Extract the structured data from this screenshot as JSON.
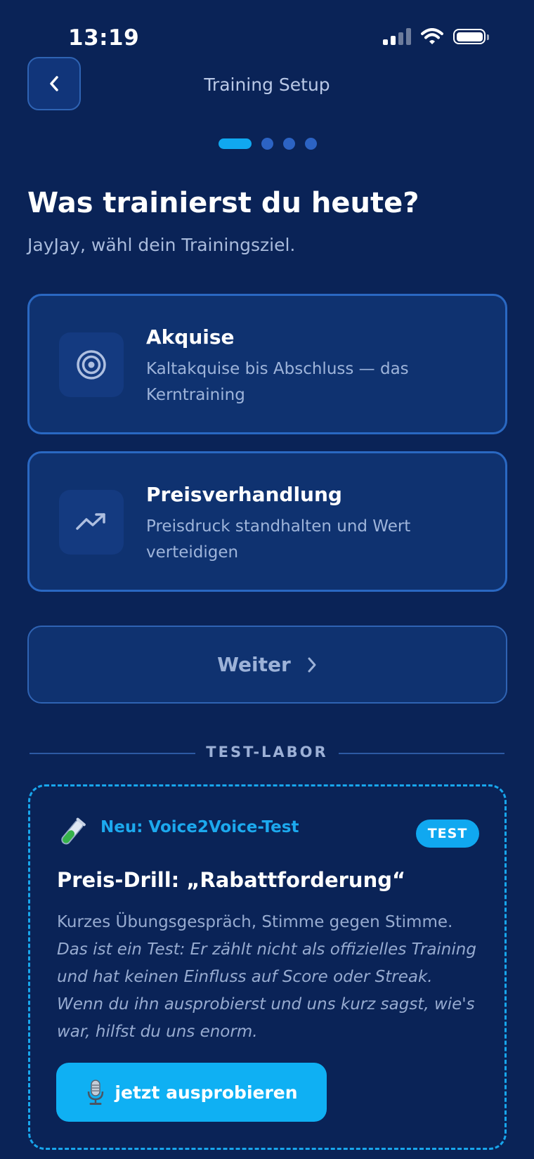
{
  "status_bar": {
    "time": "13:19"
  },
  "nav": {
    "title": "Training Setup"
  },
  "step_indicator": {
    "current": 1,
    "total": 4
  },
  "header": {
    "title": "Was trainierst du heute?",
    "subtitle": "JayJay, wähl dein Trainingsziel."
  },
  "options": [
    {
      "title": "Akquise",
      "description": "Kaltakquise bis Abschluss — das Kerntraining",
      "icon": "target-icon"
    },
    {
      "title": "Preisverhandlung",
      "description": "Preisdruck standhalten und Wert verteidigen",
      "icon": "trending-up-icon"
    }
  ],
  "continue_button": {
    "label": "Weiter"
  },
  "test_lab": {
    "section_label": "TEST-LABOR",
    "tag": "Neu: Voice2Voice-Test",
    "badge": "TEST",
    "title": "Preis-Drill: „Rabattforderung“",
    "description": "Kurzes Übungsgespräch, Stimme gegen Stimme.",
    "note": "Das ist ein Test: Er zählt nicht als offizielles Training und hat keinen Einfluss auf Score oder Streak. Wenn du ihn ausprobierst und uns kurz sagst, wie's war, hilfst du uns enorm.",
    "try_button": "jetzt ausprobieren",
    "tag_icon": "test-tube-icon",
    "button_icon": "microphone-icon"
  },
  "colors": {
    "background": "#0a2357",
    "card": "#0f3270",
    "border": "#2a68c2",
    "accent": "#10a8f0"
  }
}
